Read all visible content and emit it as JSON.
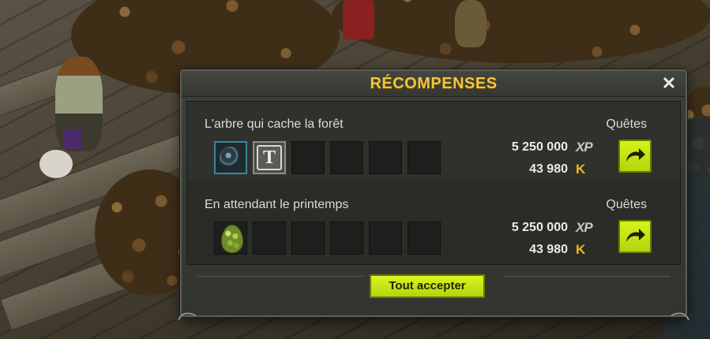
{
  "dialog": {
    "title": "RÉCOMPENSES",
    "close_symbol": "✕",
    "accept_all_label": "Tout accepter"
  },
  "quests": [
    {
      "name": "L'arbre qui cache la forêt",
      "category": "Quêtes",
      "xp": "5 250 000",
      "xp_label": "XP",
      "kamas": "43 980",
      "kamas_symbol": "K",
      "items": [
        "orb-item-icon",
        "title-t-icon"
      ]
    },
    {
      "name": "En attendant le printemps",
      "category": "Quêtes",
      "xp": "5 250 000",
      "xp_label": "XP",
      "kamas": "43 980",
      "kamas_symbol": "K",
      "items": [
        "dragoturkey-egg-icon"
      ]
    }
  ],
  "colors": {
    "title": "#f2c53d",
    "button": "#c8e414",
    "kamas": "#f0b81e"
  }
}
